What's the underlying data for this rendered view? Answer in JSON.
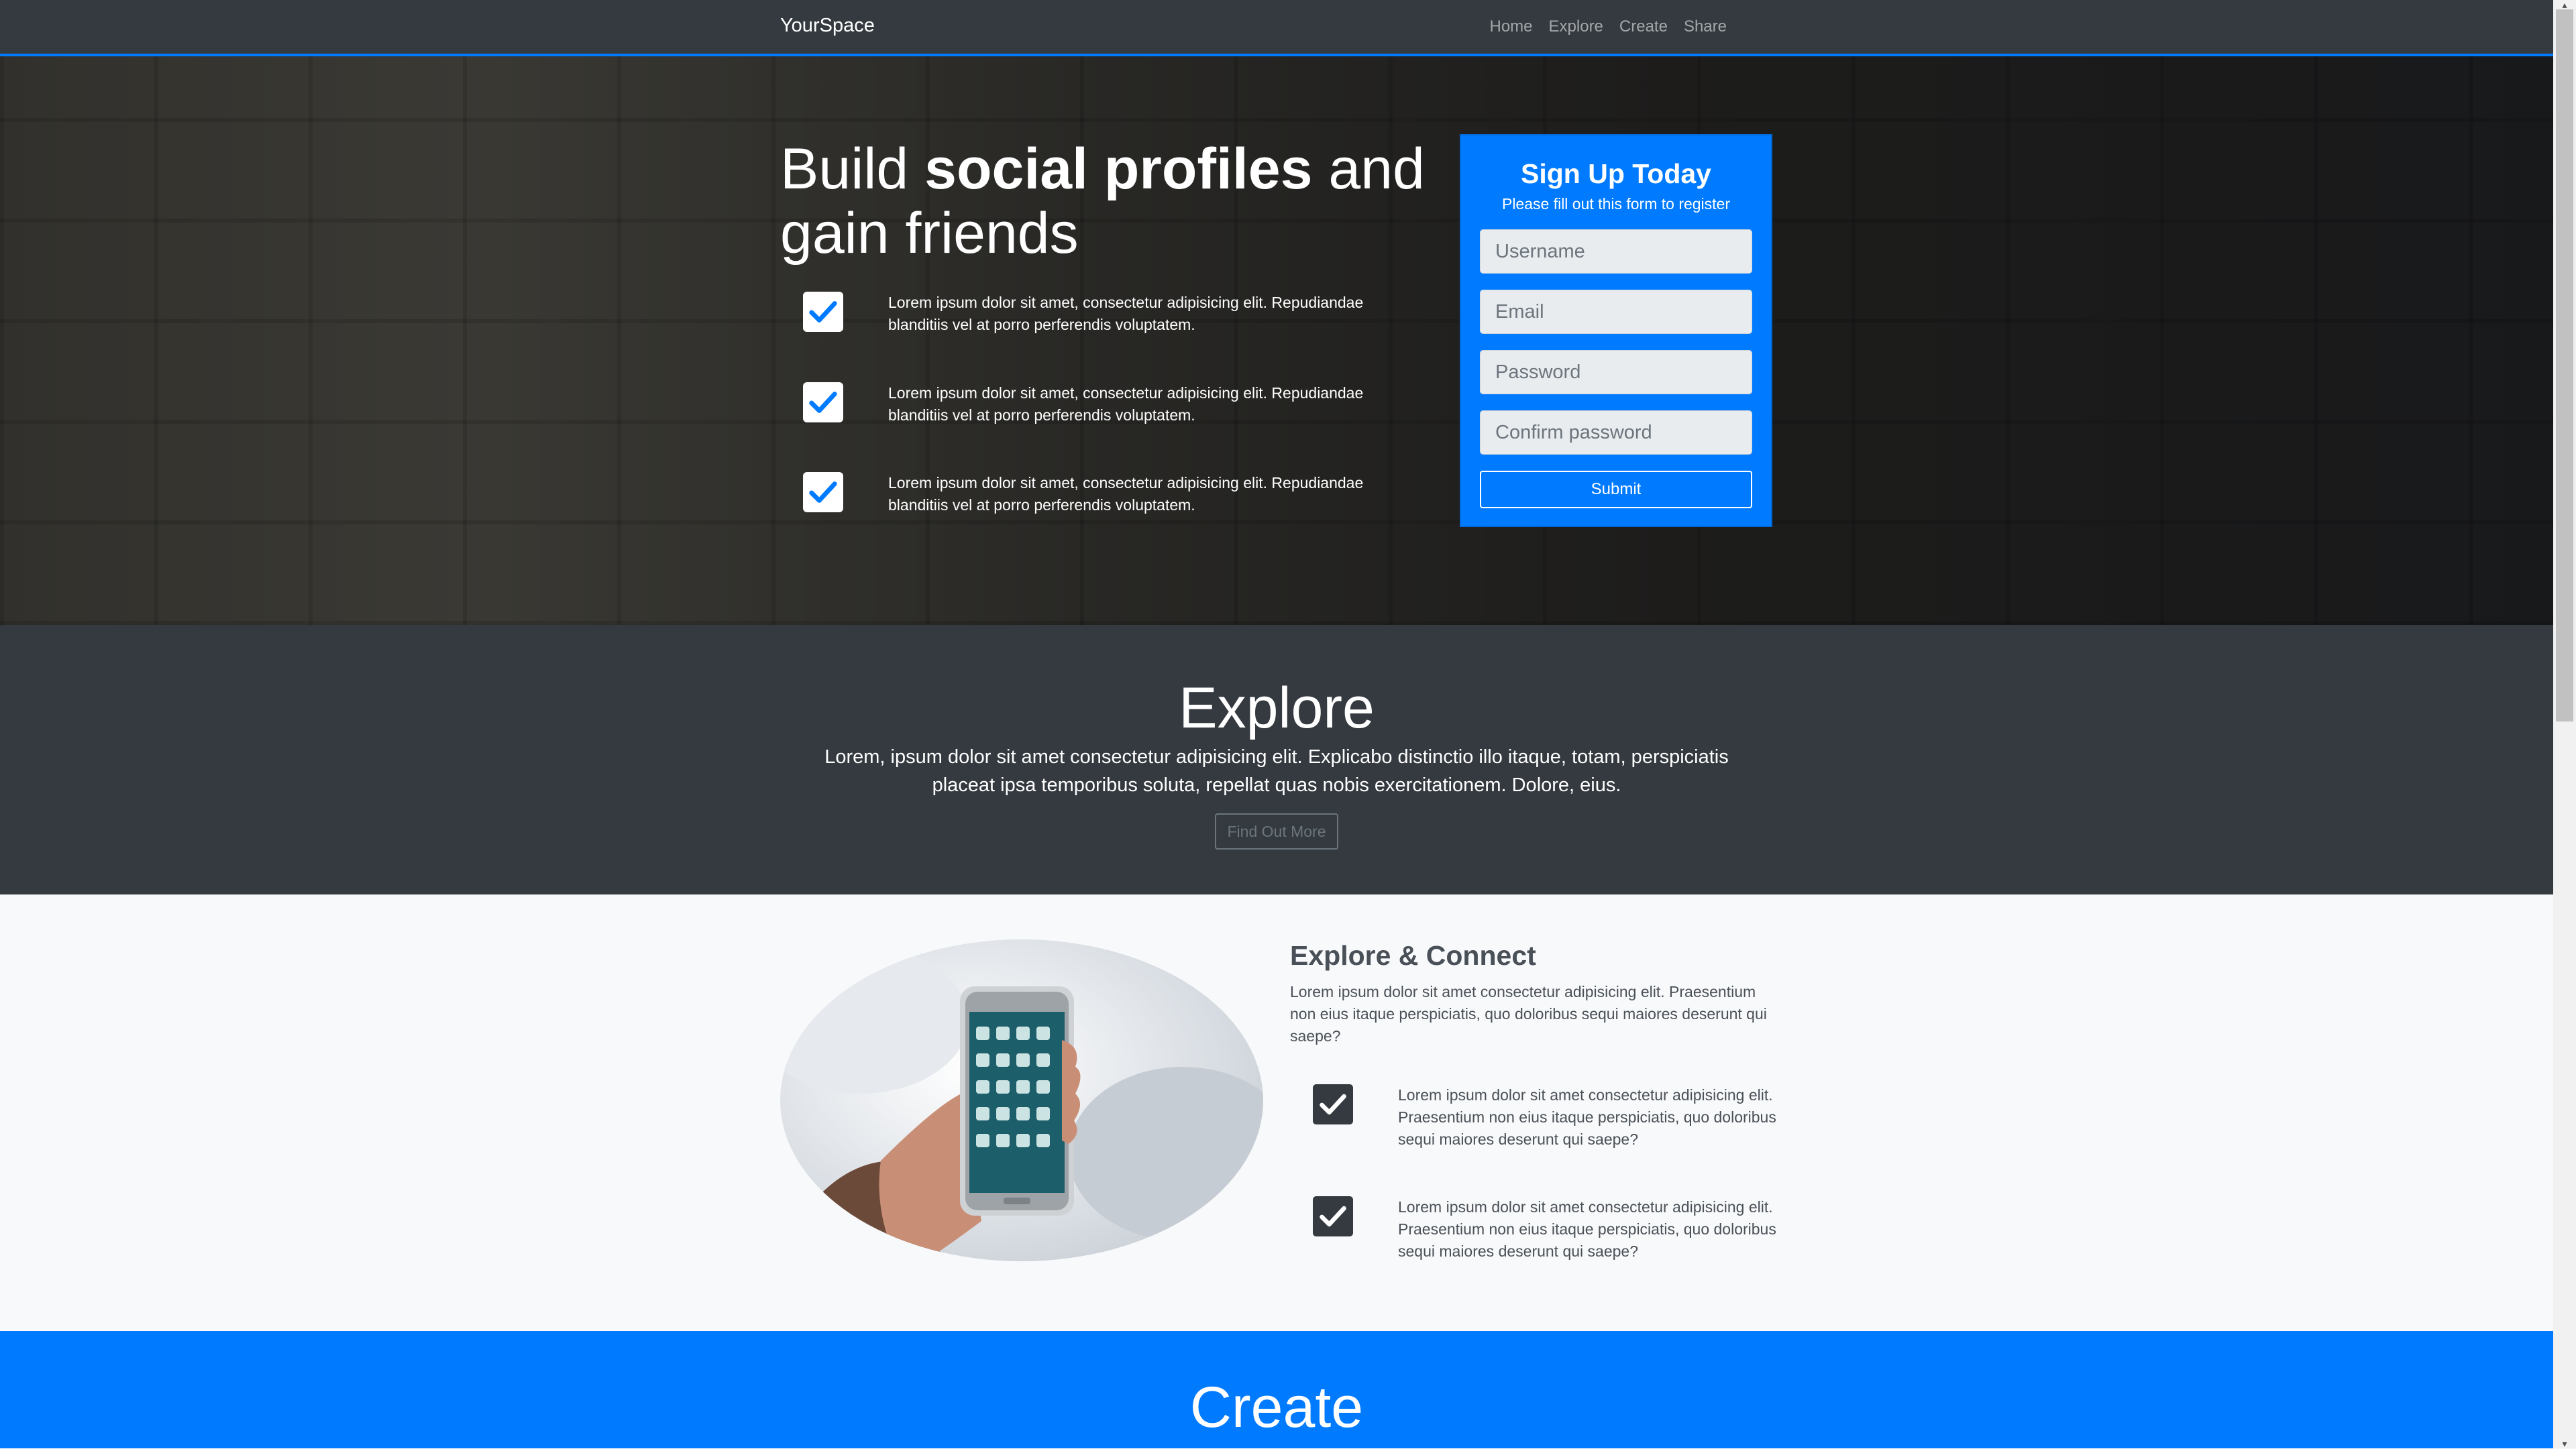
{
  "navbar": {
    "brand": "YourSpace",
    "links": [
      "Home",
      "Explore",
      "Create",
      "Share"
    ]
  },
  "hero": {
    "title_plain_1": "Build ",
    "title_bold": "social profiles",
    "title_plain_2": " and gain friends",
    "features": [
      "Lorem ipsum dolor sit amet, consectetur adipisicing elit. Repudiandae blanditiis vel at porro perferendis voluptatem.",
      "Lorem ipsum dolor sit amet, consectetur adipisicing elit. Repudiandae blanditiis vel at porro perferendis voluptatem.",
      "Lorem ipsum dolor sit amet, consectetur adipisicing elit. Repudiandae blanditiis vel at porro perferendis voluptatem."
    ]
  },
  "signup": {
    "title": "Sign Up Today",
    "subtitle": "Please fill out this form to register",
    "username_placeholder": "Username",
    "email_placeholder": "Email",
    "password_placeholder": "Password",
    "confirm_placeholder": "Confirm password",
    "submit_label": "Submit"
  },
  "explore": {
    "heading": "Explore",
    "text": "Lorem, ipsum dolor sit amet consectetur adipisicing elit. Explicabo distinctio illo itaque, totam, perspiciatis placeat ipsa temporibus soluta, repellat quas nobis exercitationem. Dolore, eius.",
    "button_label": "Find Out More"
  },
  "connect": {
    "heading": "Explore & Connect",
    "lead": "Lorem ipsum dolor sit amet consectetur adipisicing elit. Praesentium non eius itaque perspiciatis, quo doloribus sequi maiores deserunt qui saepe?",
    "items": [
      "Lorem ipsum dolor sit amet consectetur adipisicing elit. Praesentium non eius itaque perspiciatis, quo doloribus sequi maiores deserunt qui saepe?",
      "Lorem ipsum dolor sit amet consectetur adipisicing elit. Praesentium non eius itaque perspiciatis, quo doloribus sequi maiores deserunt qui saepe?"
    ]
  },
  "create": {
    "heading": "Create"
  },
  "colors": {
    "primary": "#007bff",
    "dark": "#343a40",
    "light": "#f8f9fa"
  }
}
